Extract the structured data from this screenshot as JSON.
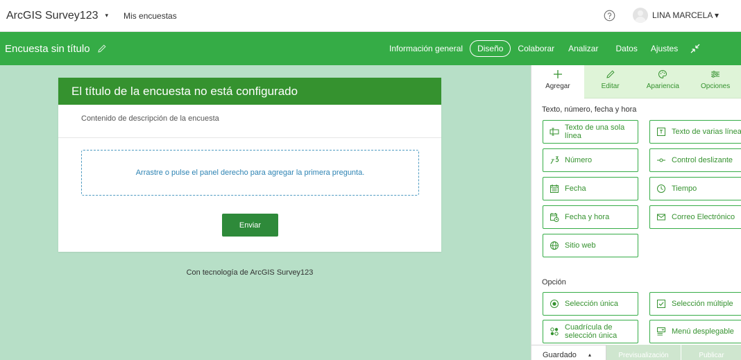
{
  "topbar": {
    "brand": "ArcGIS Survey123",
    "brand_caret": "▾",
    "my_surveys": "Mis encuestas",
    "user_name": "LINA MARCELA ▾"
  },
  "header": {
    "survey_title": "Encuesta sin título",
    "nav": [
      "Información general",
      "Diseño",
      "Colaborar",
      "Analizar",
      "Datos",
      "Ajustes"
    ],
    "active_nav": "Diseño"
  },
  "card": {
    "title": "El título de la encuesta no está configurado",
    "description": "Contenido de descripción de la encuesta",
    "dropzone_text": "Arrastre o pulse el panel derecho para agregar la primera pregunta.",
    "submit_label": "Enviar"
  },
  "powered_by": "Con tecnología de ArcGIS Survey123",
  "panel": {
    "tabs": [
      {
        "label": "Agregar",
        "icon": "plus-icon"
      },
      {
        "label": "Editar",
        "icon": "pencil-icon"
      },
      {
        "label": "Apariencia",
        "icon": "palette-icon"
      },
      {
        "label": "Opciones",
        "icon": "sliders-icon"
      }
    ],
    "section_text_title": "Texto, número, fecha y hora",
    "text_questions": [
      {
        "label": "Texto de una sola línea",
        "icon": "single-line-text-icon"
      },
      {
        "label": "Texto de varias líneas",
        "icon": "multiline-text-icon"
      },
      {
        "label": "Número",
        "icon": "number-icon"
      },
      {
        "label": "Control deslizante",
        "icon": "slider-icon"
      },
      {
        "label": "Fecha",
        "icon": "calendar-icon"
      },
      {
        "label": "Tiempo",
        "icon": "clock-icon"
      },
      {
        "label": "Fecha y hora",
        "icon": "calendar-clock-icon"
      },
      {
        "label": "Correo Electrónico",
        "icon": "envelope-icon"
      },
      {
        "label": "Sitio web",
        "icon": "globe-icon"
      }
    ],
    "section_choice_title": "Opción",
    "choice_questions": [
      {
        "label": "Selección única",
        "icon": "radio-icon"
      },
      {
        "label": "Selección múltiple",
        "icon": "checkbox-icon"
      },
      {
        "label": "Cuadrícula de selección única",
        "icon": "grid-icon"
      },
      {
        "label": "Menú desplegable",
        "icon": "dropdown-icon"
      }
    ],
    "footer": {
      "saved": "Guardado",
      "saved_caret": "▴",
      "preview": "Previsualización",
      "publish": "Publicar"
    }
  },
  "colors": {
    "brand_green": "#35ac46",
    "card_header_green": "#35922f",
    "canvas_bg": "#b7dfc7",
    "link_blue": "#2d83b3"
  }
}
